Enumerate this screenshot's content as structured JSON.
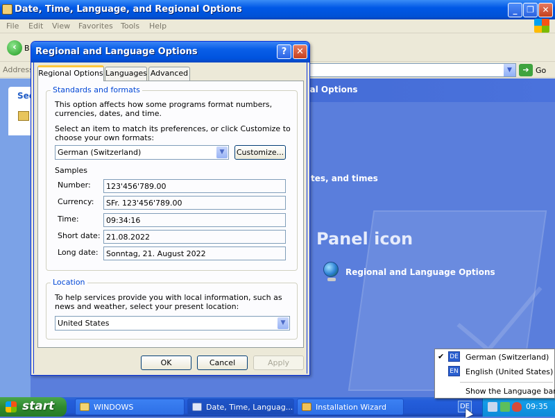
{
  "explorer": {
    "title": "Date, Time, Language, and Regional Options",
    "menu": [
      "File",
      "Edit",
      "View",
      "Favorites",
      "Tools",
      "Help"
    ],
    "back_label": "B",
    "address_label": "Address",
    "go_label": "Go",
    "see_also": "See",
    "header_text": "nal Options",
    "task_text": "tes, and times",
    "panel_heading": "Panel icon",
    "panel_link": "Regional and Language Options"
  },
  "dialog": {
    "title": "Regional and Language Options",
    "help_glyph": "?",
    "close_glyph": "✕",
    "tabs": [
      "Regional Options",
      "Languages",
      "Advanced"
    ],
    "standards": {
      "legend": "Standards and formats",
      "description": "This option affects how some programs format numbers, currencies, dates, and time.",
      "select_text": "Select an item to match its preferences, or click Customize to choose your own formats:",
      "selected_format": "German (Switzerland)",
      "customize_label": "Customize...",
      "samples_label": "Samples",
      "samples": [
        {
          "label": "Number:",
          "value": "123'456'789.00"
        },
        {
          "label": "Currency:",
          "value": "SFr. 123'456'789.00"
        },
        {
          "label": "Time:",
          "value": "09:34:16"
        },
        {
          "label": "Short date:",
          "value": "21.08.2022"
        },
        {
          "label": "Long date:",
          "value": "Sonntag, 21. August 2022"
        }
      ]
    },
    "location": {
      "legend": "Location",
      "description": "To help services provide you with local information, such as news and weather, select your present location:",
      "selected": "United States"
    },
    "buttons": {
      "ok": "OK",
      "cancel": "Cancel",
      "apply": "Apply"
    }
  },
  "taskbar": {
    "start_label": "start",
    "tasks": [
      {
        "label": "WINDOWS",
        "icon": "folder-icon"
      },
      {
        "label": "Date, Time, Languag...",
        "icon": "control-panel-icon"
      },
      {
        "label": "Installation Wizard",
        "icon": "wizard-icon"
      }
    ],
    "language_indicator": "DE",
    "time": "09:35"
  },
  "language_menu": {
    "items": [
      {
        "code": "DE",
        "label": "German (Switzerland)",
        "checked": true
      },
      {
        "code": "EN",
        "label": "English (United States)",
        "checked": false
      }
    ],
    "check_glyph": "✔",
    "show_bar_label": "Show the Language bar"
  }
}
